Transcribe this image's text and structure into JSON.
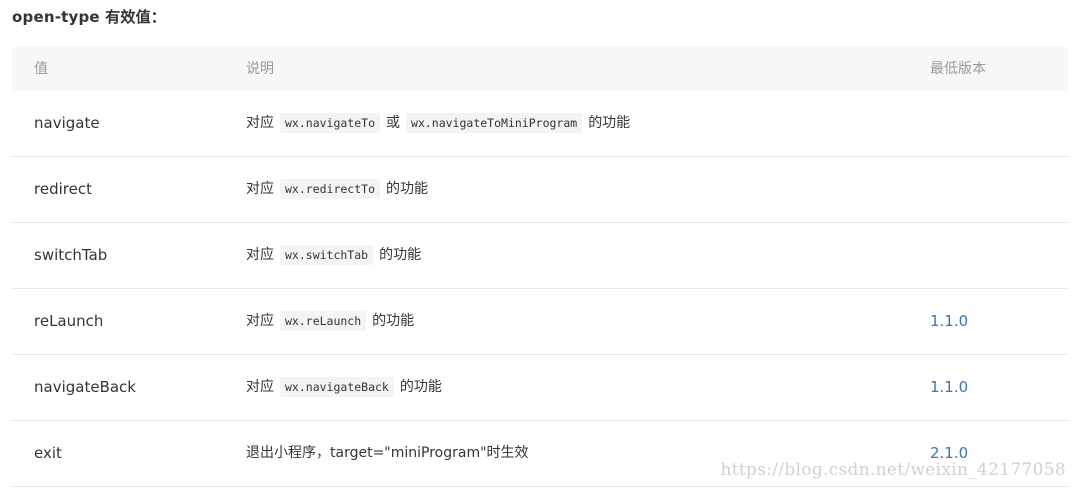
{
  "heading": "open-type 有效值：",
  "table": {
    "headers": [
      "值",
      "说明",
      "最低版本"
    ],
    "rows": [
      {
        "value": "navigate",
        "pre": "对应",
        "code1": "wx.navigateTo",
        "mid": "或",
        "code2": "wx.navigateToMiniProgram",
        "post": "的功能",
        "version": ""
      },
      {
        "value": "redirect",
        "pre": "对应",
        "code1": "wx.redirectTo",
        "post": "的功能",
        "version": ""
      },
      {
        "value": "switchTab",
        "pre": "对应",
        "code1": "wx.switchTab",
        "post": "的功能",
        "version": ""
      },
      {
        "value": "reLaunch",
        "pre": "对应",
        "code1": "wx.reLaunch",
        "post": "的功能",
        "version": "1.1.0"
      },
      {
        "value": "navigateBack",
        "pre": "对应",
        "code1": "wx.navigateBack",
        "post": "的功能",
        "version": "1.1.0"
      },
      {
        "value": "exit",
        "text": "退出小程序，target=\"miniProgram\"时生效",
        "version": "2.1.0"
      }
    ]
  },
  "watermark": "https://blog.csdn.net/weixin_42177058"
}
